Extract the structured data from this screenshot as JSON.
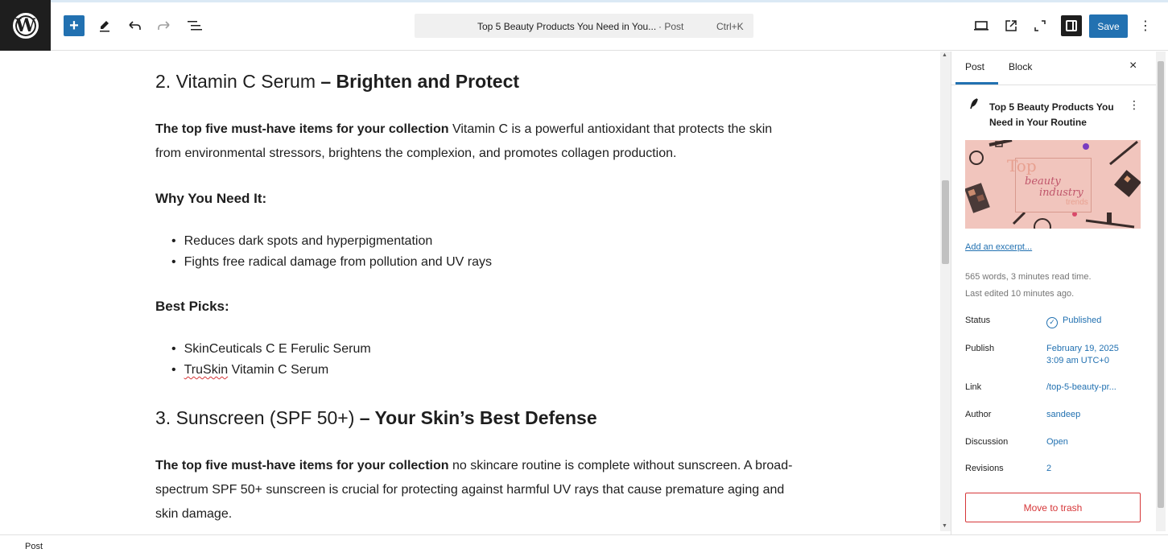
{
  "toolbar": {
    "wp_logo": "W",
    "add_icon": "+",
    "tools_icon": "pencil-icon",
    "undo_icon": "undo-icon",
    "redo_icon": "redo-icon",
    "list_view_icon": "list-view-icon",
    "command_title": "Top 5 Beauty Products You Need in You...",
    "command_type": "· Post",
    "command_shortcut": "Ctrl+K",
    "view_icon": "desktop-view-icon",
    "external_icon": "external-link-icon",
    "fullscreen_icon": "fullscreen-icon",
    "settings_icon": "sidebar-toggle-icon",
    "save_label": "Save",
    "options_icon": "⋮"
  },
  "content": {
    "h2_vitc_plain": "2. Vitamin C Serum ",
    "h2_vitc_bold": "– Brighten and Protect",
    "p1_bold": "The top five must-have items for your collection",
    "p1_rest": " Vitamin C is a powerful antioxidant that protects the skin from environmental stressors, brightens the complexion, and promotes collagen production.",
    "why_heading": "Why You Need It:",
    "why_items": [
      "Reduces dark spots and hyperpigmentation",
      "Fights free radical damage from pollution and UV rays"
    ],
    "picks_heading": "Best Picks:",
    "picks_item1": "SkinCeuticals C E Ferulic Serum",
    "picks_item2_brand": "TruSkin",
    "picks_item2_rest": " Vitamin C Serum",
    "h2_sun_plain": "3. Sunscreen (SPF 50+) ",
    "h2_sun_bold": "– Your Skin’s Best Defense",
    "p2_bold": "The top five must-have items for your collection",
    "p2_rest": " no skincare routine is complete without sunscreen. A broad-spectrum SPF 50+ sunscreen is crucial for protecting against harmful UV rays that cause premature aging and skin damage."
  },
  "sidebar": {
    "tab_post": "Post",
    "tab_block": "Block",
    "close": "×",
    "post_title": "Top 5 Beauty Products You Need in Your Routine",
    "featured_text": {
      "line1": "Top",
      "line2": "beauty",
      "line3": "industry",
      "line4": "trends"
    },
    "excerpt_link": "Add an excerpt...",
    "meta_words": "565 words, 3 minutes read time.",
    "meta_edited": "Last edited 10 minutes ago.",
    "rows": {
      "status_label": "Status",
      "status_value": "Published",
      "publish_label": "Publish",
      "publish_value_1": "February 19, 2025",
      "publish_value_2": "3:09 am UTC+0",
      "link_label": "Link",
      "link_value": "/top-5-beauty-pr...",
      "author_label": "Author",
      "author_value": "sandeep",
      "discussion_label": "Discussion",
      "discussion_value": "Open",
      "revisions_label": "Revisions",
      "revisions_value": "2"
    },
    "trash_label": "Move to trash"
  },
  "footer": {
    "breadcrumb": "Post"
  }
}
